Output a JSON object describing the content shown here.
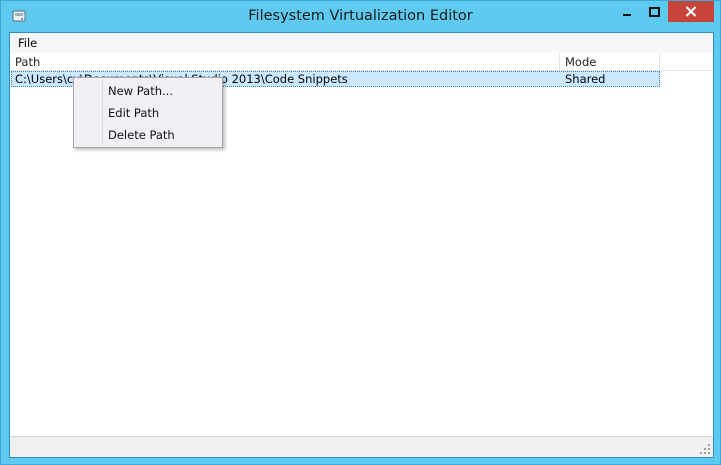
{
  "window": {
    "title": "Filesystem Virtualization Editor",
    "icons": {
      "app": "app-disk-icon",
      "minimize": "minimize-icon",
      "maximize": "maximize-icon",
      "close": "close-icon"
    },
    "colors": {
      "frame": "#5fcaf0",
      "close": "#c7443a",
      "selection": "#cce8ff"
    }
  },
  "menubar": {
    "file_label": "File"
  },
  "table": {
    "columns": [
      "Path",
      "Mode"
    ],
    "rows": [
      {
        "path": "C:\\Users\\cy\\Documents\\Visual Studio 2013\\Code Snippets",
        "mode": "Shared"
      }
    ]
  },
  "context_menu": {
    "items": [
      "New Path...",
      "Edit Path",
      "Delete Path"
    ]
  },
  "statusbar": {
    "text": "",
    "grip_icon": "resize-grip-icon"
  }
}
